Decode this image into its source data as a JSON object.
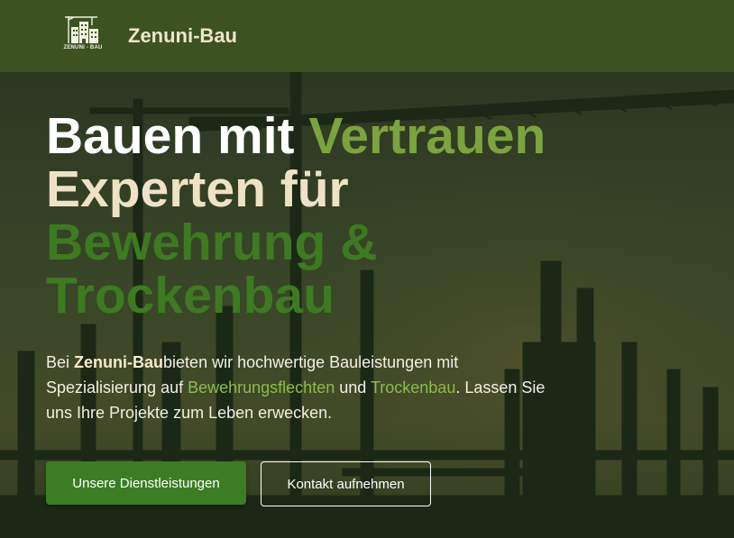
{
  "header": {
    "logo_text": "ZENUNI - BAU",
    "brand": "Zenuni-Bau"
  },
  "hero": {
    "line1_a": "Bauen mit ",
    "line1_b": "Vertrauen",
    "line2": "Experten für",
    "line3": "Bewehrung &",
    "line4": "Trockenbau",
    "lead_prefix": "Bei ",
    "lead_brand": "Zenuni-Bau",
    "lead_part1": "bieten wir hochwertige Bauleistungen mit Spezialisierung auf ",
    "lead_hl1": "Bewehrungsflechten",
    "lead_and": " und ",
    "lead_hl2": "Trockenbau",
    "lead_part2": ". Lassen Sie uns Ihre Projekte zum Leben erwecken.",
    "btn_services": "Unsere Dienstleistungen",
    "btn_contact": "Kontakt aufnehmen"
  },
  "colors": {
    "header_bg": "#3c5220",
    "brand_text": "#efe6cc",
    "accent_light_green": "#7ba33e",
    "accent_dark_green": "#3d7a22",
    "cream": "#eee2c6",
    "primary_button": "#3b7d25"
  }
}
